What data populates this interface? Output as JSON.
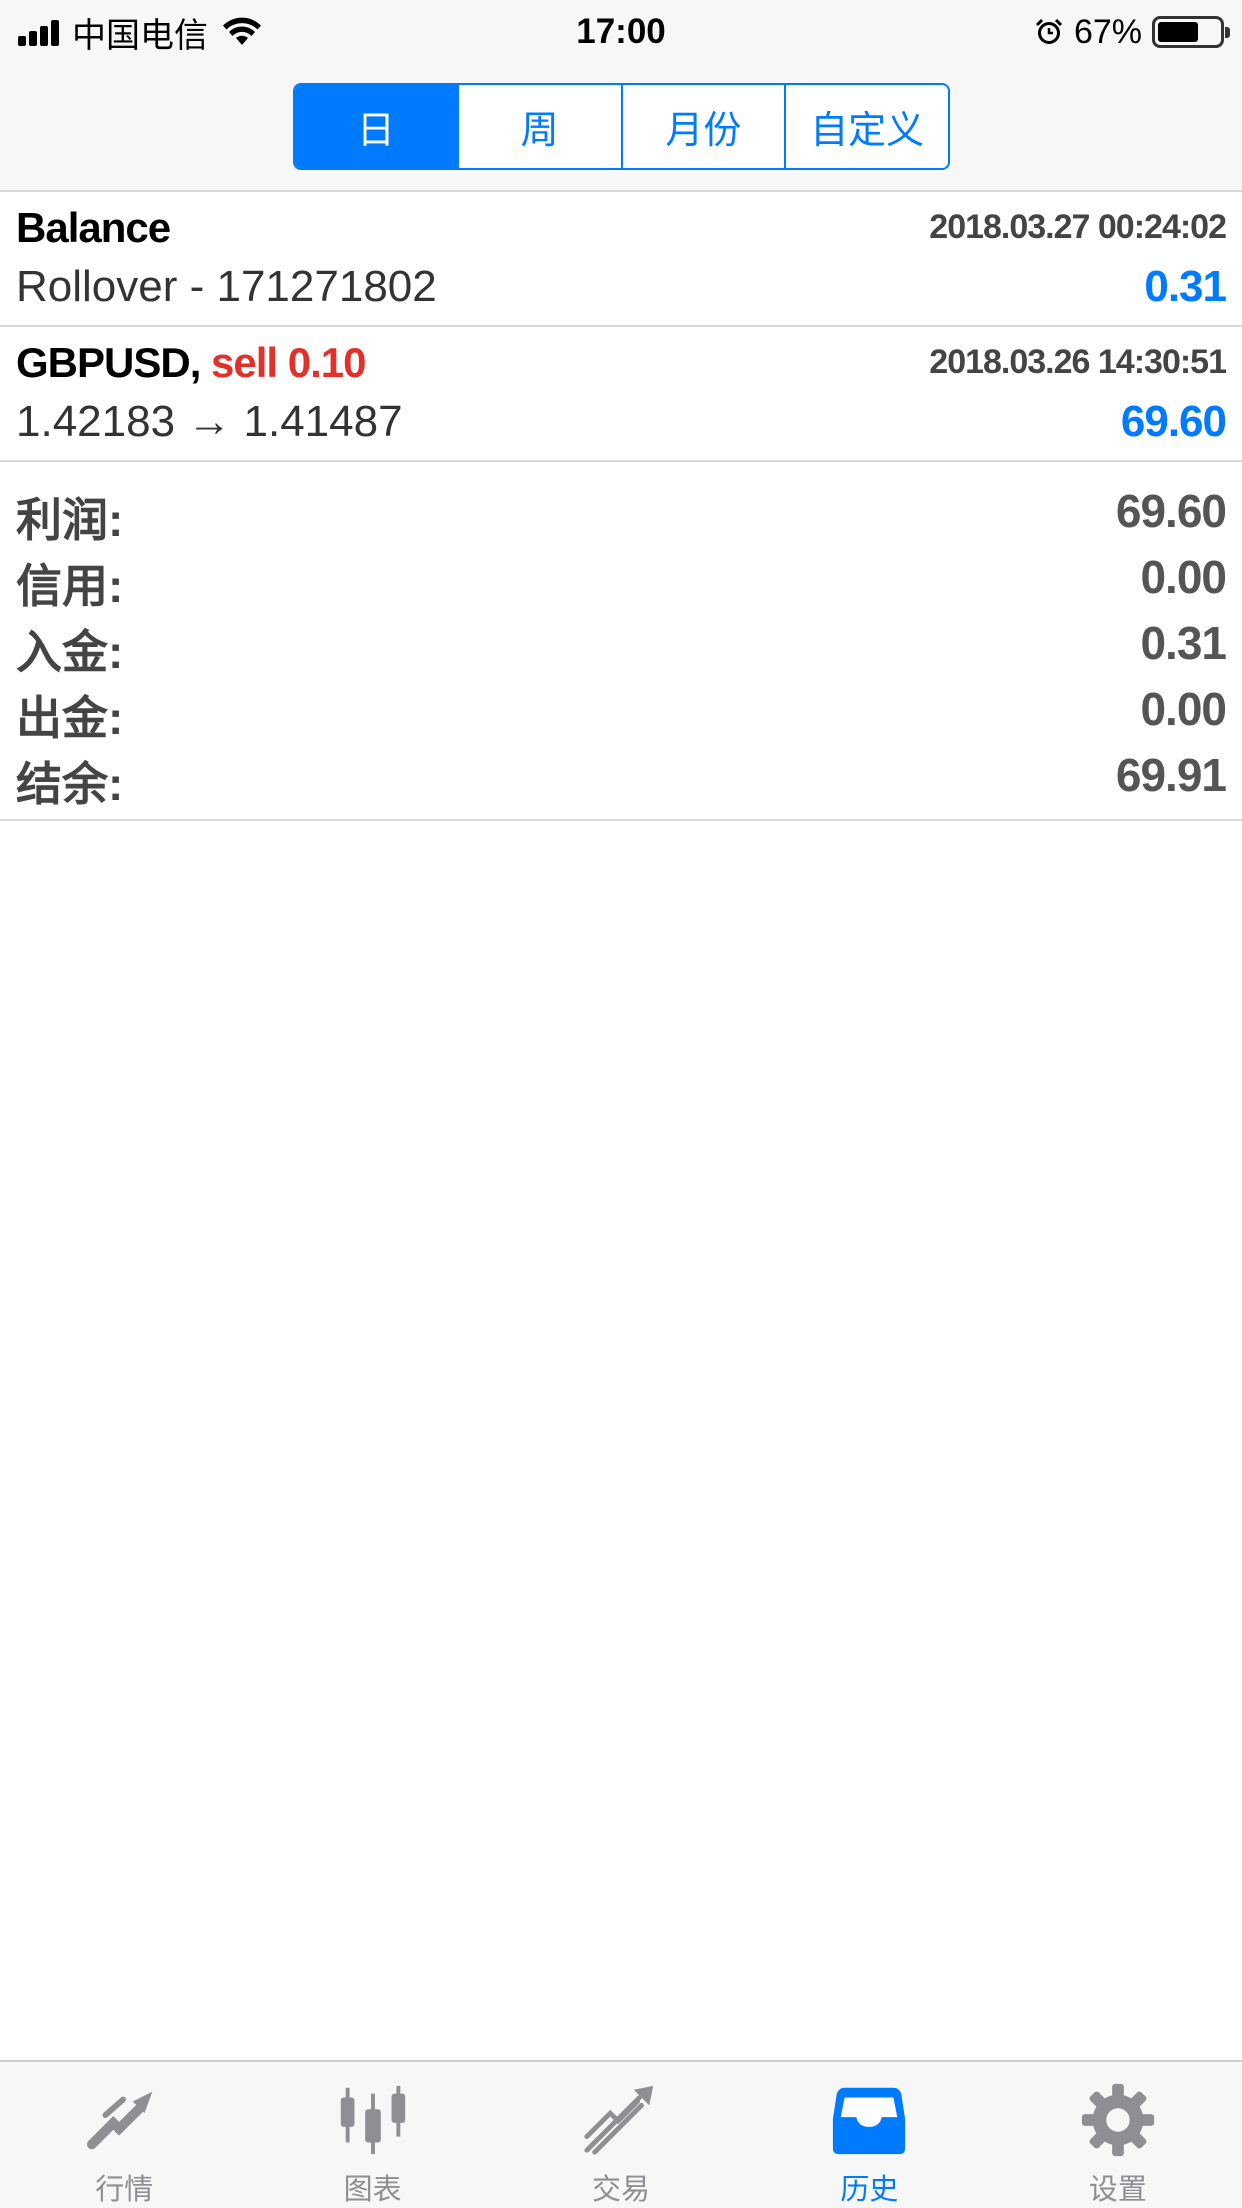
{
  "status_bar": {
    "carrier": "中国电信",
    "time": "17:00",
    "battery_percent": "67%",
    "battery_level": 0.67
  },
  "period_tabs": [
    {
      "label": "日",
      "active": true
    },
    {
      "label": "周",
      "active": false
    },
    {
      "label": "月份",
      "active": false
    },
    {
      "label": "自定义",
      "active": false
    }
  ],
  "deals": [
    {
      "symbol": "Balance",
      "side": "",
      "time": "2018.03.27 00:24:02",
      "description": "Rollover - 171271802",
      "amount": "0.31"
    },
    {
      "symbol": "GBPUSD,",
      "side": "sell 0.10",
      "time": "2018.03.26 14:30:51",
      "description": "1.42183 → 1.41487",
      "amount": "69.60"
    }
  ],
  "summary": [
    {
      "label": "利润:",
      "value": "69.60"
    },
    {
      "label": "信用:",
      "value": "0.00"
    },
    {
      "label": "入金:",
      "value": "0.31"
    },
    {
      "label": "出金:",
      "value": "0.00"
    },
    {
      "label": "结余:",
      "value": "69.91"
    }
  ],
  "tab_bar": [
    {
      "label": "行情",
      "icon": "quotes-icon",
      "active": false
    },
    {
      "label": "图表",
      "icon": "chart-candles-icon",
      "active": false
    },
    {
      "label": "交易",
      "icon": "trade-icon",
      "active": false
    },
    {
      "label": "历史",
      "icon": "history-inbox-icon",
      "active": true
    },
    {
      "label": "设置",
      "icon": "gear-icon",
      "active": false
    }
  ],
  "colors": {
    "accent": "#007aff",
    "sell": "#e0312a",
    "inactive_icon": "#8e8e93"
  }
}
